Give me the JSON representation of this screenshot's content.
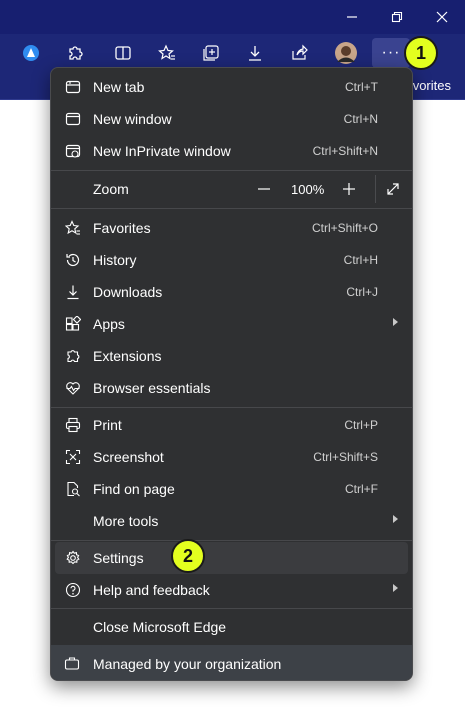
{
  "window": {
    "minimize_icon": "minimize-icon",
    "restore_icon": "restore-icon",
    "close_icon": "close-icon"
  },
  "toolbar": {
    "icons": [
      "copilot-icon",
      "extensions-icon",
      "split-screen-icon",
      "favorites-icon",
      "collections-icon",
      "downloads-icon",
      "share-icon",
      "profile-avatar",
      "more-icon"
    ],
    "more_label": "···",
    "favorites_bar_text": "avorites"
  },
  "badges": {
    "first": "1",
    "second": "2"
  },
  "menu": {
    "new_tab": {
      "label": "New tab",
      "shortcut": "Ctrl+T"
    },
    "new_window": {
      "label": "New window",
      "shortcut": "Ctrl+N"
    },
    "new_inprivate": {
      "label": "New InPrivate window",
      "shortcut": "Ctrl+Shift+N"
    },
    "zoom": {
      "label": "Zoom",
      "minus": "—",
      "value": "100%",
      "plus": "+"
    },
    "favorites": {
      "label": "Favorites",
      "shortcut": "Ctrl+Shift+O"
    },
    "history": {
      "label": "History",
      "shortcut": "Ctrl+H"
    },
    "downloads": {
      "label": "Downloads",
      "shortcut": "Ctrl+J"
    },
    "apps": {
      "label": "Apps"
    },
    "extensions": {
      "label": "Extensions"
    },
    "browser_essentials": {
      "label": "Browser essentials"
    },
    "print": {
      "label": "Print",
      "shortcut": "Ctrl+P"
    },
    "screenshot": {
      "label": "Screenshot",
      "shortcut": "Ctrl+Shift+S"
    },
    "find_on_page": {
      "label": "Find on page",
      "shortcut": "Ctrl+F"
    },
    "more_tools": {
      "label": "More tools"
    },
    "settings": {
      "label": "Settings"
    },
    "help": {
      "label": "Help and feedback"
    },
    "close_edge": {
      "label": "Close Microsoft Edge"
    },
    "managed": {
      "label": "Managed by your organization"
    }
  },
  "colors": {
    "titlebar": "#171f70",
    "menu_bg": "#2f3032",
    "badge": "#e3ff1f"
  }
}
